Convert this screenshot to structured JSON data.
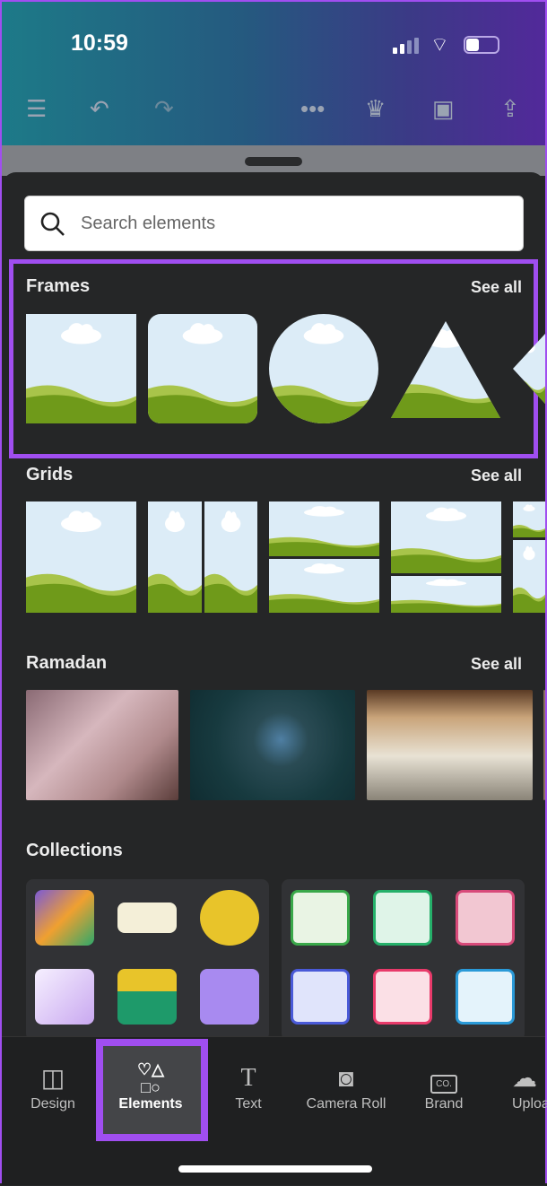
{
  "status_bar": {
    "time": "10:59"
  },
  "toolbar": {
    "icons": [
      "menu-icon",
      "undo-icon",
      "redo-icon",
      "more-icon",
      "crown-icon",
      "present-icon",
      "share-icon"
    ]
  },
  "search": {
    "placeholder": "Search elements"
  },
  "sections": [
    {
      "title": "Frames",
      "see_all": "See all"
    },
    {
      "title": "Grids",
      "see_all": "See all"
    },
    {
      "title": "Ramadan",
      "see_all": "See all"
    },
    {
      "title": "Collections"
    }
  ],
  "bottom_nav": [
    {
      "label": "Design",
      "icon": "layout-icon"
    },
    {
      "label": "Elements",
      "icon": "shapes-icon",
      "active": true
    },
    {
      "label": "Text",
      "icon": "text-icon"
    },
    {
      "label": "Camera Roll",
      "icon": "camera-icon"
    },
    {
      "label": "Brand",
      "icon": "brand-icon",
      "icon_text": "CO."
    },
    {
      "label": "Uploa",
      "icon": "upload-cloud-icon"
    }
  ],
  "colors": {
    "highlight": "#a04ef0",
    "panel": "#252627",
    "sky": "#dcecf7",
    "grass": "#6f9a1a"
  }
}
